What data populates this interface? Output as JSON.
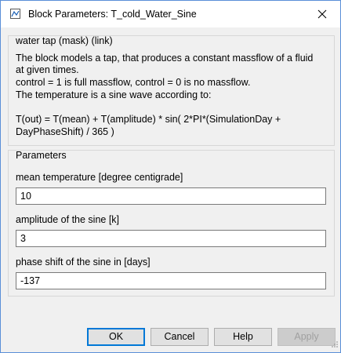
{
  "window": {
    "title": "Block Parameters: T_cold_Water_Sine"
  },
  "icons": {
    "app": "simulink-block-icon",
    "close": "close-icon",
    "resize": "resize-grip-icon"
  },
  "mask_group": {
    "title": "water tap (mask) (link)",
    "lines": [
      "The block models a tap, that produces a constant massflow of a fluid",
      "at given times.",
      "control = 1 is full massflow, control = 0 is no massflow.",
      "The temperature is a sine wave according to:",
      "",
      "T(out) = T(mean) + T(amplitude) * sin( 2*PI*(SimulationDay +",
      "DayPhaseShift) / 365 )"
    ]
  },
  "params_group": {
    "title": "Parameters",
    "fields": [
      {
        "label": "mean temperature [degree centigrade]",
        "value": "10"
      },
      {
        "label": "amplitude of the sine [k]",
        "value": "3"
      },
      {
        "label": "phase shift of the sine in [days]",
        "value": "-137"
      }
    ]
  },
  "buttons": {
    "ok": "OK",
    "cancel": "Cancel",
    "help": "Help",
    "apply": "Apply"
  }
}
